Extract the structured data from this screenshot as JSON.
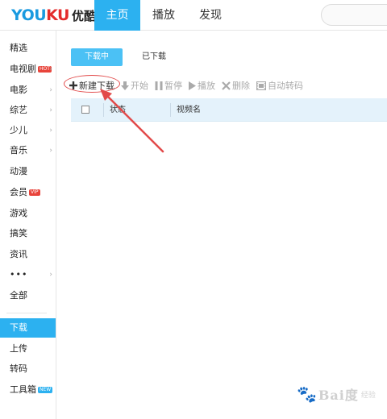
{
  "header": {
    "logo_latin": "YOUKU",
    "logo_cn": "优酷",
    "tabs": [
      {
        "label": "主页",
        "active": true
      },
      {
        "label": "播放",
        "active": false
      },
      {
        "label": "发现",
        "active": false
      }
    ]
  },
  "sidebar": {
    "items": [
      {
        "label": "精选",
        "arrow": false
      },
      {
        "label": "电视剧",
        "badge": "HOT",
        "arrow": true
      },
      {
        "label": "电影",
        "arrow": true
      },
      {
        "label": "综艺",
        "arrow": true
      },
      {
        "label": "少儿",
        "arrow": true
      },
      {
        "label": "音乐",
        "arrow": true
      },
      {
        "label": "动漫",
        "arrow": false
      },
      {
        "label": "会员",
        "badge": "VIP",
        "arrow": false
      },
      {
        "label": "游戏",
        "arrow": false
      },
      {
        "label": "搞笑",
        "arrow": false
      },
      {
        "label": "资讯",
        "arrow": false
      },
      {
        "label": "•••",
        "arrow": true
      },
      {
        "label": "全部",
        "arrow": false
      }
    ],
    "tools": [
      {
        "label": "下载",
        "active": true
      },
      {
        "label": "上传",
        "active": false
      },
      {
        "label": "转码",
        "active": false
      },
      {
        "label": "工具箱",
        "badge": "NEW",
        "active": false
      }
    ],
    "arrow_glyph": "›"
  },
  "download": {
    "tabs": {
      "downloading": "下载中",
      "downloaded": "已下载"
    },
    "toolbar": {
      "new": "新建下载",
      "start": "开始",
      "pause": "暂停",
      "play": "播放",
      "delete": "删除",
      "transcode": "自动转码"
    },
    "table": {
      "columns": [
        "状态",
        "视频名"
      ]
    }
  },
  "watermark": {
    "brand": "Bai度",
    "sub": "经验"
  },
  "colors": {
    "accent": "#2cb1f0",
    "annotation": "#e24a4a",
    "table_header": "#e4f2fb"
  }
}
